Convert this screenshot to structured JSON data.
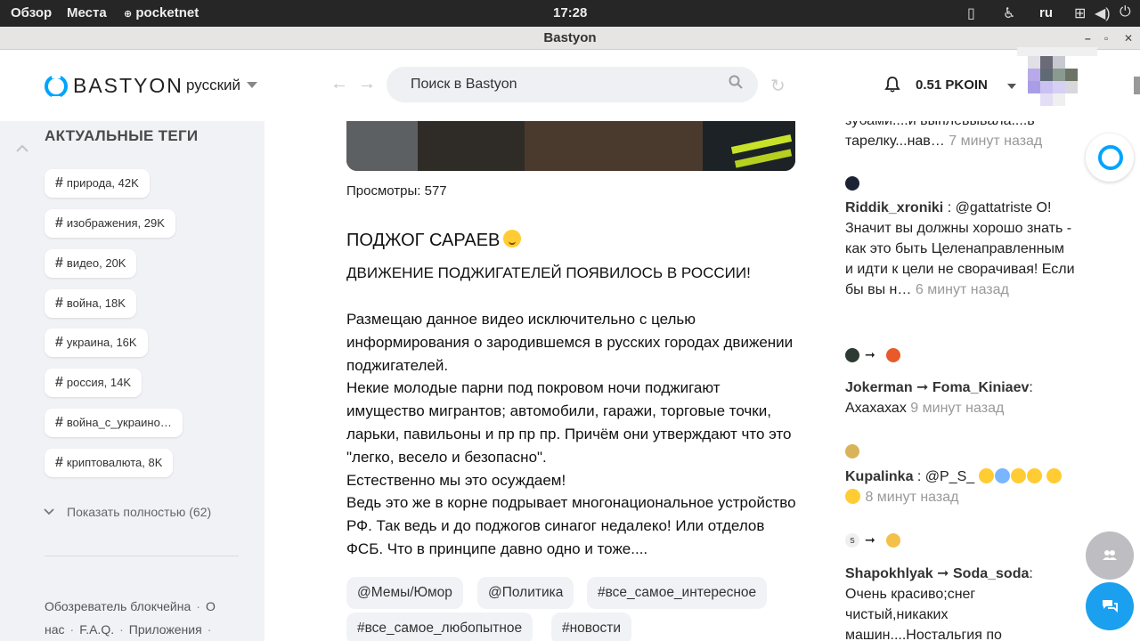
{
  "system_bar": {
    "activities": "Обзор",
    "places": "Места",
    "app_name": "pocketnet",
    "clock": "17:28",
    "keyboard_layout": "ru"
  },
  "window": {
    "title": "Bastyon",
    "controls": {
      "minimize": "–",
      "maximize": "▫",
      "close": "✕"
    }
  },
  "header": {
    "logo_text": "BASTYON",
    "language": "русский",
    "search_placeholder": "Поиск в Bastyon",
    "balance": "0.51 PKOIN",
    "accent_color": "#00a4ff"
  },
  "sidebar": {
    "title": "АКТУАЛЬНЫЕ ТЕГИ",
    "tags": [
      {
        "label": "природа, 42K"
      },
      {
        "label": "изображения, 29K"
      },
      {
        "label": "видео, 20K"
      },
      {
        "label": "война, 18K"
      },
      {
        "label": "украина, 16K"
      },
      {
        "label": "россия, 14K"
      },
      {
        "label": "война_с_украино…"
      },
      {
        "label": "криптовалюта, 8K"
      }
    ],
    "show_all": "Показать полностью (62)",
    "footer_links": [
      "Обозреватель блокчейна",
      "О нас",
      "F.A.Q.",
      "Приложения"
    ]
  },
  "post": {
    "views": "Просмотры: 577",
    "title": "ПОДЖОГ САРАЕВ",
    "subtitle": "ДВИЖЕНИЕ ПОДЖИГАТЕЛЕЙ ПОЯВИЛОСЬ В РОССИИ!",
    "paragraphs": [
      "Размещаю данное видео исключительно с целью информирования о зародившемся в русских городах движении поджигателей.",
      "Некие молодые парни под покровом ночи поджигают имущество мигрантов; автомобили, гаражи, торговые точки, ларьки, павильоны и пр пр пр. Причём они утверждают что это \"легко, весело и безопасно\".",
      "Естественно мы это осуждаем!",
      "Ведь это же в корне подрывает многонациональное устройство РФ. Так ведь и до поджогов синагог недалеко! Или отделов ФСБ. Что в принципе давно одно и тоже...."
    ],
    "tags": [
      "@Мемы/Юмор",
      "@Политика",
      "#все_самое_интересное",
      "#все_самое_любопытное",
      "#новости"
    ]
  },
  "activity": [
    {
      "text": "зубами....и выплевывала....в тарелку...нав…",
      "time": "7 минут назад"
    },
    {
      "user": "Riddik_xroniki",
      "text": " : @gattatriste О! Значит вы должны хорошо знать - как это быть Целенаправленным и идти к цели не сворачивая! Если бы вы н…",
      "time": "6 минут назад"
    },
    {
      "user": "Jokerman ➞ Foma_Kiniaev",
      "text": ": Ахахахах",
      "time": "9 минут назад"
    },
    {
      "user": "Kupalinka",
      "text": " : @P_S_",
      "time": "8 минут назад"
    },
    {
      "user": "Shapokhlyak ➞ Soda_soda",
      "text": ": Очень красиво;снег чистый,никаких машин....Ностальгия по"
    }
  ],
  "activity_avatar_initial": "s"
}
